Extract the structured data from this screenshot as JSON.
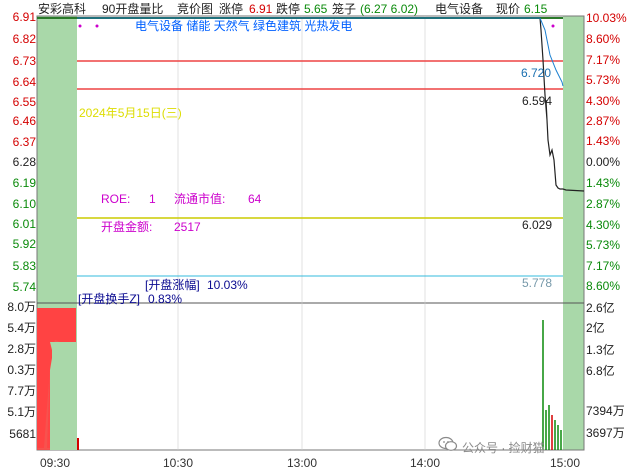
{
  "header": {
    "stock_name": "安彩高科",
    "open_ratio_label": "90开盘量比",
    "auction_label": "竞价图",
    "limit_up_label": "涨停",
    "limit_up_value": "6.91",
    "limit_down_label": "跌停",
    "limit_down_value": "5.65",
    "cage_label": "笼子",
    "cage_value": "(6.27 6.02)",
    "sector_label": "电气设备",
    "current_price_label": "现价",
    "current_price_value": "6.15"
  },
  "left_price_axis": [
    "6.91",
    "6.82",
    "6.73",
    "6.64",
    "6.55",
    "6.46",
    "6.37",
    "6.28",
    "6.19",
    "6.10",
    "6.01",
    "5.92",
    "5.83",
    "5.74"
  ],
  "right_pct_axis": [
    "10.03%",
    "8.60%",
    "7.17%",
    "5.73%",
    "4.30%",
    "2.87%",
    "1.43%",
    "0.00%",
    "1.43%",
    "2.87%",
    "4.30%",
    "5.73%",
    "7.17%",
    "8.60%"
  ],
  "left_volume_axis": [
    "8.0万",
    "5.4万",
    "2.8万",
    "0.3万",
    "7.7万",
    "5.1万",
    "5681"
  ],
  "right_amount_axis": [
    "2.6亿",
    "2亿",
    "1.3亿",
    "6.8亿",
    "7394万",
    "3697万"
  ],
  "time_axis": [
    "09:30",
    "10:30",
    "13:00",
    "14:00",
    "15:00"
  ],
  "concept_tags": "电气设备 储能 天然气 绿色建筑 光热发电",
  "date_overlay": "2024年5月15日(三)",
  "info": {
    "roe_label": "ROE:",
    "roe_value": "1",
    "float_cap_label": "流通市值:",
    "float_cap_value": "64",
    "open_amount_label": "开盘金额:",
    "open_amount_value": "2517"
  },
  "price_marks": {
    "upper": "6.720",
    "mid": "6.594",
    "lower": "6.029",
    "bottom": "5.778"
  },
  "open_change_label": "[开盘涨幅]",
  "open_change_value": "10.03%",
  "open_turnover_label": "[开盘换手Z]",
  "open_turnover_value": "0.83%",
  "watermark": "公众号 · 捡财猫",
  "colors": {
    "up_red": "#d40000",
    "down_green": "#0a8a0a",
    "panel_green": "#a9d8a9",
    "volume_red": "#ff4444",
    "ref_red": "#ee4444",
    "yellow_line": "#cccc00",
    "cyan_line": "#33bbdd",
    "magenta": "#cc00cc",
    "tag_blue": "#0060ff"
  }
}
